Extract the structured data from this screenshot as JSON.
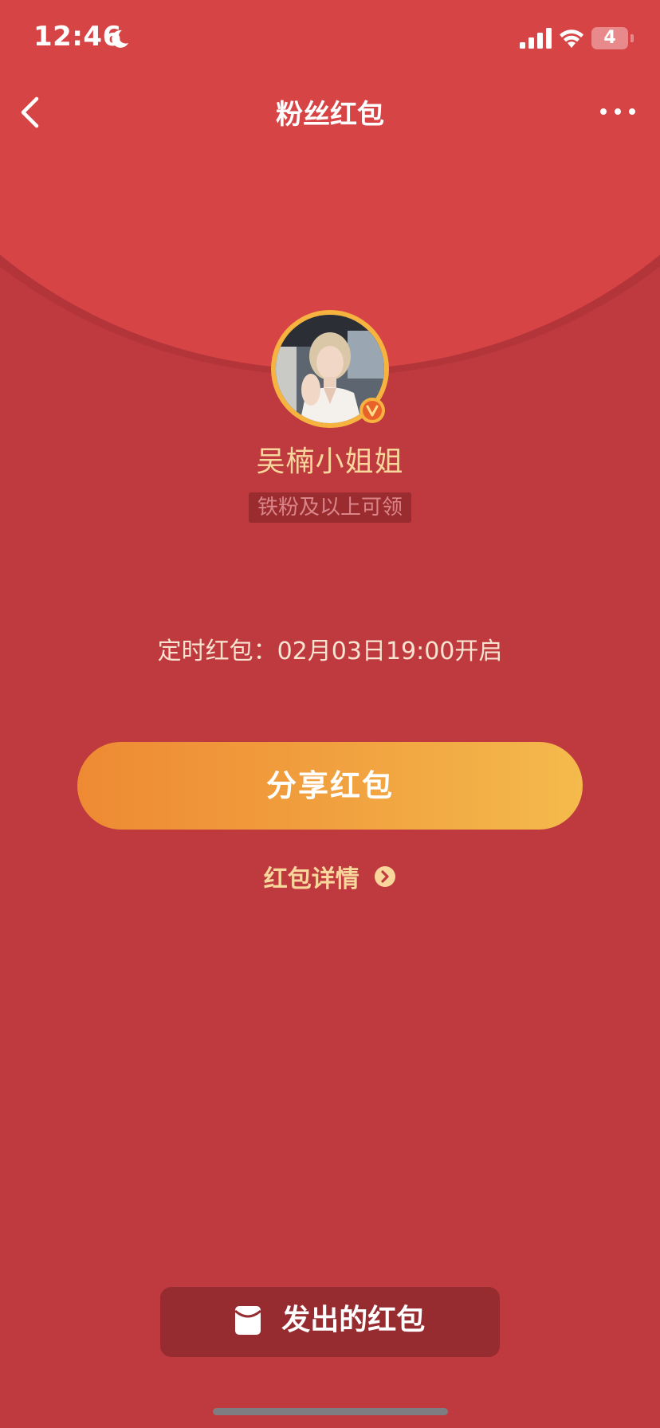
{
  "status_bar": {
    "time": "12:46",
    "battery_level": "4"
  },
  "nav": {
    "title": "粉丝红包"
  },
  "profile": {
    "username": "吴楠小姐姐",
    "eligibility": "铁粉及以上可领"
  },
  "timer": {
    "text": "定时红包：02月03日19:00开启"
  },
  "actions": {
    "share_label": "分享红包",
    "details_label": "红包详情",
    "sent_label": "发出的红包"
  },
  "colors": {
    "background": "#BE3A3F",
    "cover": "#D64445",
    "gold_text": "#F9D79C",
    "button_gradient_start": "#EE8A33",
    "button_gradient_end": "#F4BA4C"
  }
}
